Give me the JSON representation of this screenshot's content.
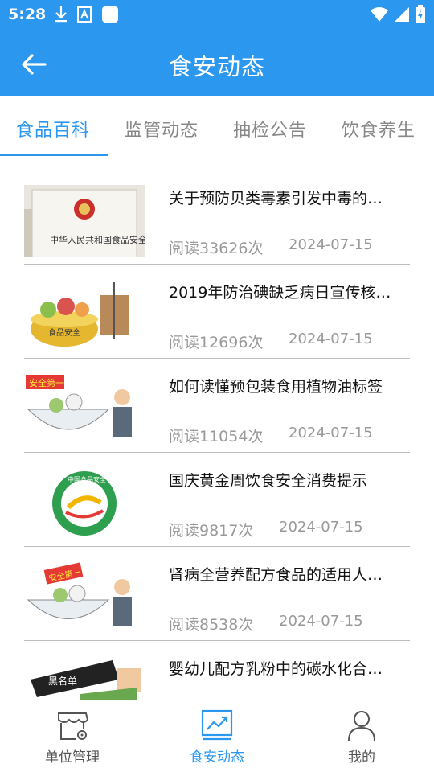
{
  "status_bar": {
    "time": "5:28",
    "left_icons": [
      "download-icon",
      "font-a-icon",
      "app-square-icon"
    ],
    "right_icons": [
      "wifi-icon",
      "signal-icon",
      "battery-charging-icon"
    ]
  },
  "header": {
    "title": "食安动态",
    "back_icon": "back-arrow-icon"
  },
  "tabs": [
    {
      "label": "食品百科",
      "active": true
    },
    {
      "label": "监管动态",
      "active": false
    },
    {
      "label": "抽检公告",
      "active": false
    },
    {
      "label": "饮食养生",
      "active": false
    }
  ],
  "articles": [
    {
      "title": "关于预防贝类毒素引发中毒的…",
      "reads": "阅读33626次",
      "date": "2024-07-15",
      "thumb_text": "中华人民共和国食品安全法"
    },
    {
      "title": "2019年防治碘缺乏病日宣传核…",
      "reads": "阅读12696次",
      "date": "2024-07-15",
      "thumb_text": "食品安全"
    },
    {
      "title": "如何读懂预包装食用植物油标签",
      "reads": "阅读11054次",
      "date": "2024-07-15",
      "thumb_text": "安全第一"
    },
    {
      "title": "国庆黄金周饮食安全消费提示",
      "reads": "阅读9817次",
      "date": "2024-07-15",
      "thumb_text": "中国食品安全"
    },
    {
      "title": "肾病全营养配方食品的适用人…",
      "reads": "阅读8538次",
      "date": "2024-07-15",
      "thumb_text": "安全第一"
    },
    {
      "title": "婴幼儿配方乳粉中的碳水化合…",
      "reads": "",
      "date": "",
      "thumb_text": "黑名单"
    }
  ],
  "bottom_nav": [
    {
      "label": "单位管理",
      "icon": "store-settings-icon",
      "active": false
    },
    {
      "label": "食安动态",
      "icon": "trend-chart-icon",
      "active": true
    },
    {
      "label": "我的",
      "icon": "person-icon",
      "active": false
    }
  ],
  "colors": {
    "primary": "#2b97ef",
    "text": "#111111",
    "muted": "#999999"
  }
}
